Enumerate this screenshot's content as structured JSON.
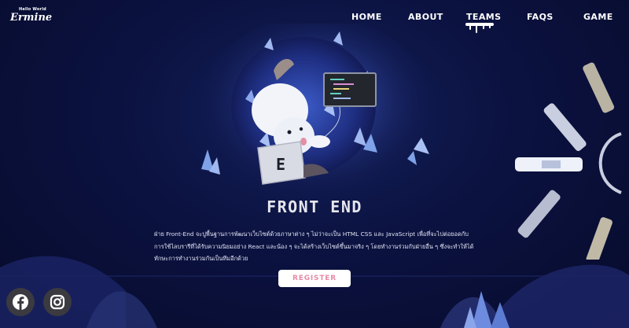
{
  "brand": {
    "small": "Hello World",
    "name": "Ermine"
  },
  "nav": {
    "items": [
      {
        "label": "HOME"
      },
      {
        "label": "ABOUT"
      },
      {
        "label": "TEAMS"
      },
      {
        "label": "FAQS"
      },
      {
        "label": "GAME"
      }
    ],
    "active": "TEAMS"
  },
  "section": {
    "title": "FRONT END",
    "description": "ฝ่าย Front-End จะปูพื้นฐานการพัฒนาเว็บไซต์ด้วยภาษาต่าง ๆ ไม่ว่าจะเป็น HTML CSS และ JavaScript เพื่อที่จะไปต่อยอดกับการใช้ไลบรารีที่ได้รับความนิยมอย่าง React และน้อง ๆ จะได้สร้างเว็บไซต์ขึ้นมาจริง ๆ โดยทำงานร่วมกับฝ่ายอื่น ๆ ซึ่งจะทำให้ได้ทักษะการทำงานร่วมกันเป็นทีมอีกด้วย",
    "register_label": "REGISTER",
    "keycap_letter": "E"
  },
  "social": [
    {
      "name": "facebook",
      "icon": "facebook-icon"
    },
    {
      "name": "instagram",
      "icon": "instagram-icon"
    }
  ],
  "colors": {
    "background": "#0b1240",
    "accent_pink": "#e88ba6",
    "text": "#ffffff",
    "crystal": "#7fa2e8"
  }
}
